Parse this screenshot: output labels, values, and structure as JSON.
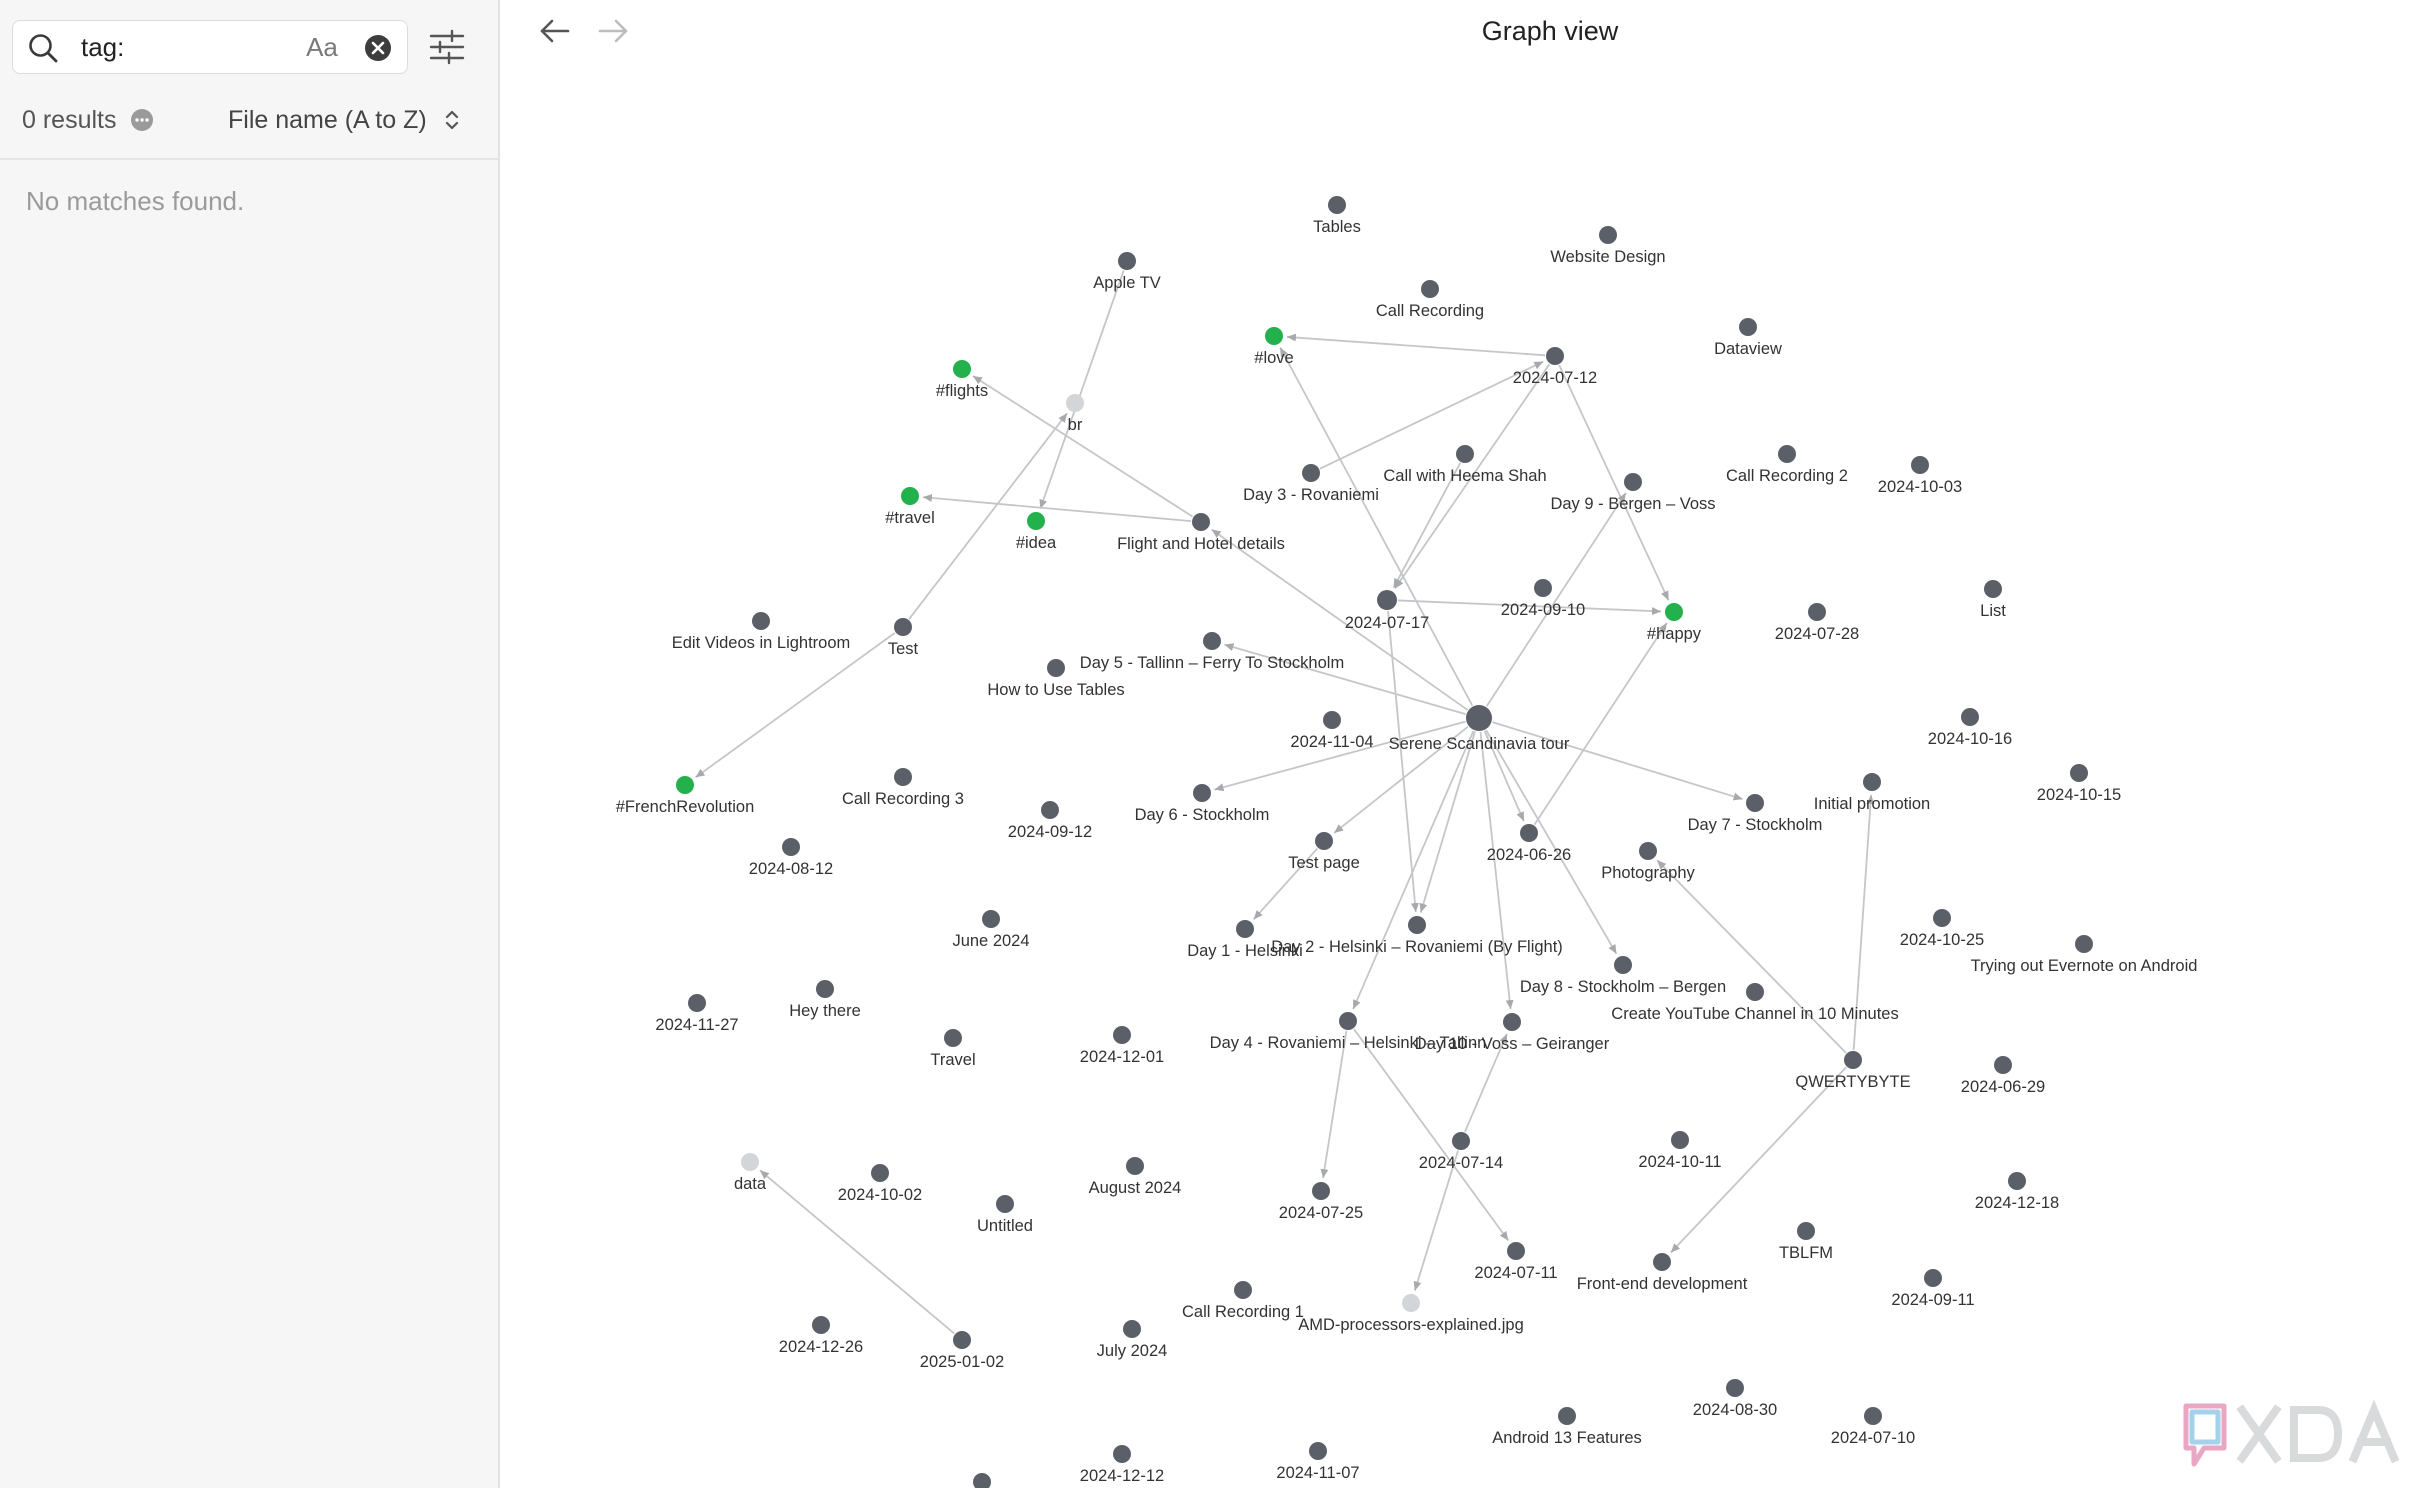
{
  "search": {
    "query": "tag:",
    "case_label": "Aa",
    "results_count": "0 results",
    "sort_label": "File name (A to Z)",
    "empty_message": "No matches found.",
    "icons": [
      "search-icon",
      "clear-icon",
      "filter-settings-icon",
      "more-options-icon",
      "sort-chevron-icon"
    ]
  },
  "view": {
    "title": "Graph view",
    "icons": [
      "back-arrow-icon",
      "forward-arrow-icon"
    ]
  },
  "watermark": {
    "text": "XDA"
  },
  "colors": {
    "note_node": "#5b6068",
    "tag_node": "#22b14c",
    "attachment_node": "#d3d5d8",
    "edge": "#c4c6ca"
  },
  "graph": {
    "nodes": [
      {
        "id": "tables",
        "label": "Tables",
        "type": "note"
      },
      {
        "id": "website-design",
        "label": "Website Design",
        "type": "note"
      },
      {
        "id": "apple-tv",
        "label": "Apple TV",
        "type": "note"
      },
      {
        "id": "call-recording",
        "label": "Call Recording",
        "type": "note"
      },
      {
        "id": "dataview",
        "label": "Dataview",
        "type": "note"
      },
      {
        "id": "love",
        "label": "#love",
        "type": "tag"
      },
      {
        "id": "d20240712",
        "label": "2024-07-12",
        "type": "note"
      },
      {
        "id": "flights",
        "label": "#flights",
        "type": "tag"
      },
      {
        "id": "br",
        "label": "br",
        "type": "attachment"
      },
      {
        "id": "call-heema",
        "label": "Call with Heema Shah",
        "type": "note"
      },
      {
        "id": "call-recording-2",
        "label": "Call Recording 2",
        "type": "note"
      },
      {
        "id": "d20241003",
        "label": "2024-10-03",
        "type": "note"
      },
      {
        "id": "day3",
        "label": "Day 3 - Rovaniemi",
        "type": "note"
      },
      {
        "id": "day9",
        "label": "Day 9 - Bergen – Voss",
        "type": "note"
      },
      {
        "id": "travel-tag",
        "label": "#travel",
        "type": "tag"
      },
      {
        "id": "idea",
        "label": "#idea",
        "type": "tag"
      },
      {
        "id": "flight-hotel",
        "label": "Flight and Hotel details",
        "type": "note"
      },
      {
        "id": "list",
        "label": "List",
        "type": "note"
      },
      {
        "id": "d20240717",
        "label": "2024-07-17",
        "type": "note"
      },
      {
        "id": "d20240910",
        "label": "2024-09-10",
        "type": "note"
      },
      {
        "id": "happy",
        "label": "#happy",
        "type": "tag"
      },
      {
        "id": "d20240728",
        "label": "2024-07-28",
        "type": "note"
      },
      {
        "id": "edit-videos",
        "label": "Edit Videos in Lightroom",
        "type": "note"
      },
      {
        "id": "test",
        "label": "Test",
        "type": "note"
      },
      {
        "id": "day5",
        "label": "Day 5 - Tallinn – Ferry To Stockholm",
        "type": "note"
      },
      {
        "id": "how-tables",
        "label": "How to Use Tables",
        "type": "note"
      },
      {
        "id": "serene",
        "label": "Serene Scandinavia tour",
        "type": "note"
      },
      {
        "id": "d20241104",
        "label": "2024-11-04",
        "type": "note"
      },
      {
        "id": "d20241016",
        "label": "2024-10-16",
        "type": "note"
      },
      {
        "id": "d20241015",
        "label": "2024-10-15",
        "type": "note"
      },
      {
        "id": "initial-promo",
        "label": "Initial promotion",
        "type": "note"
      },
      {
        "id": "french-rev",
        "label": "#FrenchRevolution",
        "type": "tag"
      },
      {
        "id": "call-recording-3",
        "label": "Call Recording 3",
        "type": "note"
      },
      {
        "id": "d20240912",
        "label": "2024-09-12",
        "type": "note"
      },
      {
        "id": "day6",
        "label": "Day 6 - Stockholm",
        "type": "note"
      },
      {
        "id": "day7",
        "label": "Day 7 - Stockholm",
        "type": "note"
      },
      {
        "id": "d20240626",
        "label": "2024-06-26",
        "type": "note"
      },
      {
        "id": "d20240812",
        "label": "2024-08-12",
        "type": "note"
      },
      {
        "id": "test-page",
        "label": "Test page",
        "type": "note"
      },
      {
        "id": "photography",
        "label": "Photography",
        "type": "note"
      },
      {
        "id": "june2024",
        "label": "June 2024",
        "type": "note"
      },
      {
        "id": "d20241025",
        "label": "2024-10-25",
        "type": "note"
      },
      {
        "id": "evernote",
        "label": "Trying out Evernote on Android",
        "type": "note"
      },
      {
        "id": "day1",
        "label": "Day 1 - Helsinki",
        "type": "note"
      },
      {
        "id": "day2",
        "label": "Day 2 - Helsinki – Rovaniemi (By Flight)",
        "type": "note"
      },
      {
        "id": "day8",
        "label": "Day 8 - Stockholm – Bergen",
        "type": "note"
      },
      {
        "id": "youtube",
        "label": "Create YouTube Channel in 10 Minutes",
        "type": "note"
      },
      {
        "id": "d20241127",
        "label": "2024-11-27",
        "type": "note"
      },
      {
        "id": "hey-there",
        "label": "Hey there",
        "type": "note"
      },
      {
        "id": "travel",
        "label": "Travel",
        "type": "note"
      },
      {
        "id": "d20241201",
        "label": "2024-12-01",
        "type": "note"
      },
      {
        "id": "day4",
        "label": "Day 4 - Rovaniemi – Helsinki – Tallinn",
        "type": "note"
      },
      {
        "id": "day10",
        "label": "Day 10 - Voss – Geiranger",
        "type": "note"
      },
      {
        "id": "qwertybyte",
        "label": "QWERTYBYTE",
        "type": "note"
      },
      {
        "id": "d20240629",
        "label": "2024-06-29",
        "type": "note"
      },
      {
        "id": "d20240714",
        "label": "2024-07-14",
        "type": "note"
      },
      {
        "id": "d20241011",
        "label": "2024-10-11",
        "type": "note"
      },
      {
        "id": "data",
        "label": "data",
        "type": "attachment"
      },
      {
        "id": "d20241002",
        "label": "2024-10-02",
        "type": "note"
      },
      {
        "id": "untitled",
        "label": "Untitled",
        "type": "note"
      },
      {
        "id": "august2024",
        "label": "August 2024",
        "type": "note"
      },
      {
        "id": "d20240725",
        "label": "2024-07-25",
        "type": "note"
      },
      {
        "id": "d20241218",
        "label": "2024-12-18",
        "type": "note"
      },
      {
        "id": "d20240711",
        "label": "2024-07-11",
        "type": "note"
      },
      {
        "id": "tblfm",
        "label": "TBLFM",
        "type": "note"
      },
      {
        "id": "front-end",
        "label": "Front-end development",
        "type": "note"
      },
      {
        "id": "d20240911",
        "label": "2024-09-11",
        "type": "note"
      },
      {
        "id": "call-recording-1",
        "label": "Call Recording 1",
        "type": "note"
      },
      {
        "id": "amd",
        "label": "AMD-processors-explained.jpg",
        "type": "attachment"
      },
      {
        "id": "d20241226",
        "label": "2024-12-26",
        "type": "note"
      },
      {
        "id": "d20250102",
        "label": "2025-01-02",
        "type": "note"
      },
      {
        "id": "july2024",
        "label": "July 2024",
        "type": "note"
      },
      {
        "id": "d20240830",
        "label": "2024-08-30",
        "type": "note"
      },
      {
        "id": "d20240710",
        "label": "2024-07-10",
        "type": "note"
      },
      {
        "id": "android13",
        "label": "Android 13 Features",
        "type": "note"
      },
      {
        "id": "d20241212",
        "label": "2024-12-12",
        "type": "note"
      },
      {
        "id": "d20241107",
        "label": "2024-11-07",
        "type": "note"
      },
      {
        "id": "unlabeled-bottom",
        "label": "",
        "type": "note"
      }
    ],
    "edges": [
      [
        "apple-tv",
        "idea"
      ],
      [
        "test",
        "br"
      ],
      [
        "test",
        "french-rev"
      ],
      [
        "flight-hotel",
        "flights"
      ],
      [
        "flight-hotel",
        "travel-tag"
      ],
      [
        "d20240712",
        "love"
      ],
      [
        "d20240712",
        "d20240717"
      ],
      [
        "d20240712",
        "happy"
      ],
      [
        "day3",
        "d20240712"
      ],
      [
        "serene",
        "love"
      ],
      [
        "serene",
        "flight-hotel"
      ],
      [
        "serene",
        "day5"
      ],
      [
        "serene",
        "day6"
      ],
      [
        "serene",
        "day7"
      ],
      [
        "serene",
        "day8"
      ],
      [
        "serene",
        "day2"
      ],
      [
        "serene",
        "day10"
      ],
      [
        "serene",
        "day4"
      ],
      [
        "serene",
        "test-page"
      ],
      [
        "serene",
        "d20240626"
      ],
      [
        "serene",
        "day9"
      ],
      [
        "d20240717",
        "happy"
      ],
      [
        "d20240717",
        "day2"
      ],
      [
        "call-heema",
        "d20240717"
      ],
      [
        "d20240626",
        "happy"
      ],
      [
        "test-page",
        "day1"
      ],
      [
        "day4",
        "d20240725"
      ],
      [
        "day4",
        "d20240711"
      ],
      [
        "d20240714",
        "amd"
      ],
      [
        "d20240714",
        "day10"
      ],
      [
        "qwertybyte",
        "initial-promo"
      ],
      [
        "qwertybyte",
        "photography"
      ],
      [
        "qwertybyte",
        "front-end"
      ],
      [
        "d20250102",
        "data"
      ]
    ]
  }
}
